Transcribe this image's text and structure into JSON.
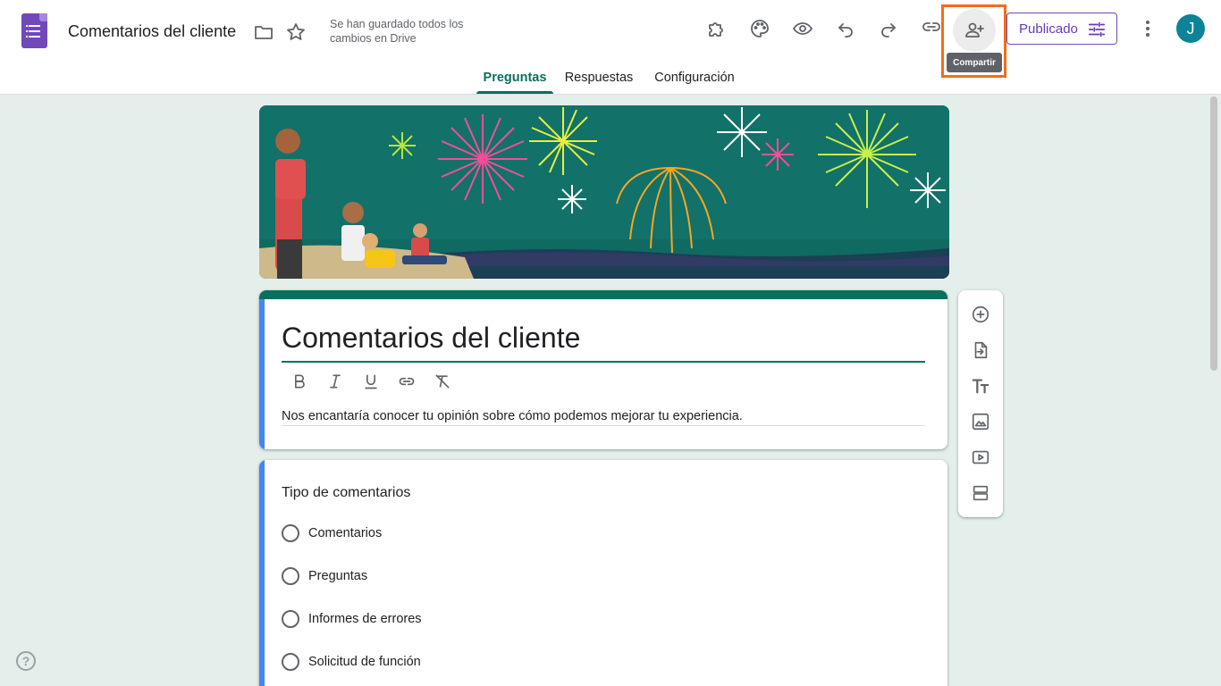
{
  "header": {
    "doc_title": "Comentarios del cliente",
    "saved_status": "Se han guardado todos los cambios en Drive",
    "share_tooltip": "Compartir",
    "publish_label": "Publicado",
    "avatar_initial": "J",
    "icons": [
      "forms-logo-icon",
      "folder-icon",
      "star-icon",
      "addon-puzzle-icon",
      "palette-icon",
      "eye-preview-icon",
      "undo-icon",
      "redo-icon",
      "link-icon",
      "person-add-icon",
      "tune-icon",
      "more-vert-icon"
    ]
  },
  "tabs": [
    {
      "label": "Preguntas",
      "active": true
    },
    {
      "label": "Respuestas",
      "active": false
    },
    {
      "label": "Configuración",
      "active": false
    }
  ],
  "form": {
    "title": "Comentarios del cliente",
    "description": "Nos encantaría conocer tu opinión sobre cómo podemos mejorar tu experiencia."
  },
  "question": {
    "title": "Tipo de comentarios",
    "options": [
      "Comentarios",
      "Preguntas",
      "Informes de errores",
      "Solicitud de función"
    ]
  },
  "side_toolbar": [
    "add-question-icon",
    "import-questions-icon",
    "add-title-icon",
    "add-image-icon",
    "add-video-icon",
    "add-section-icon"
  ],
  "colors": {
    "accent": "#0b6f5f",
    "brand": "#7248b9",
    "highlight": "#f76b15",
    "background": "#e4efeb",
    "question_bar": "#4285f4"
  }
}
